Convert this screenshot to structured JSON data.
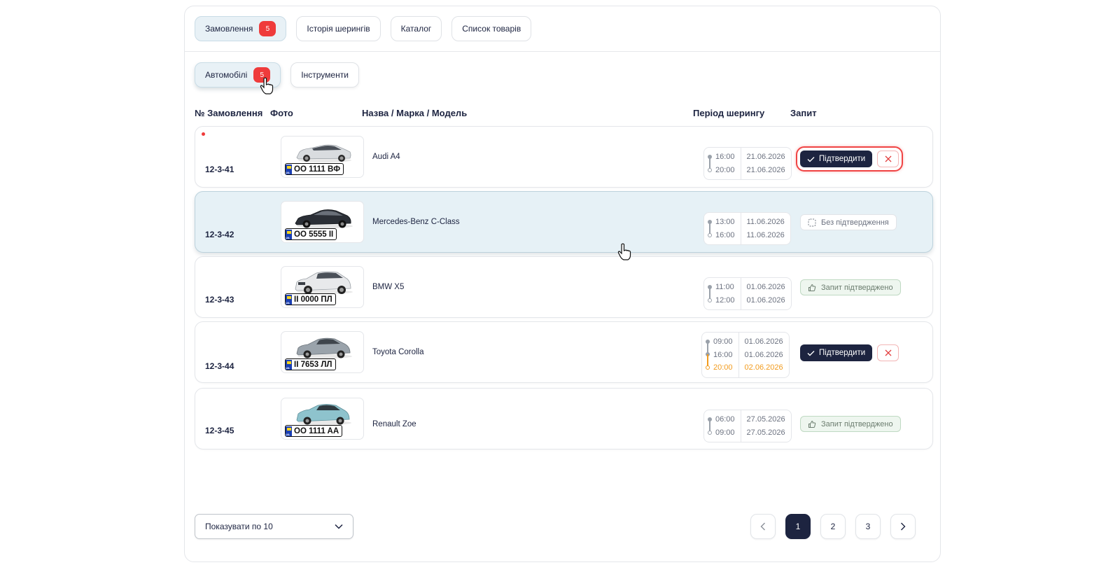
{
  "top_tabs": [
    {
      "label": "Замовлення",
      "badge": "5",
      "active": true
    },
    {
      "label": "Історія шерингів"
    },
    {
      "label": "Каталог"
    },
    {
      "label": "Список товарів"
    }
  ],
  "sub_tabs": [
    {
      "label": "Автомобілі",
      "badge": "5",
      "active": true
    },
    {
      "label": "Інструменти"
    }
  ],
  "table": {
    "headers": {
      "order": "№ Замовлення",
      "photo": "Фото",
      "name": "Назва / Марка / Модель",
      "period": "Період шерингу",
      "request": "Запит"
    },
    "rows": [
      {
        "order": "12-3-41",
        "plate": "OO 1111 BФ",
        "name": "Audi A4",
        "times": [
          "16:00",
          "20:00"
        ],
        "dates": [
          "21.06.2026",
          "21.06.2026"
        ],
        "confirm_label": "Підтвердити"
      },
      {
        "order": "12-3-42",
        "plate": "OO 5555 II",
        "name": "Mercedes-Benz C-Class",
        "times": [
          "13:00",
          "16:00"
        ],
        "dates": [
          "11.06.2026",
          "11.06.2026"
        ],
        "status": "Без підтвердження"
      },
      {
        "order": "12-3-43",
        "plate": "II 0000 ПЛ",
        "name": "BMW X5",
        "times": [
          "11:00",
          "12:00"
        ],
        "dates": [
          "01.06.2026",
          "01.06.2026"
        ],
        "status": "Запит підтверджено"
      },
      {
        "order": "12-3-44",
        "plate": "II 7653 ЛЛ",
        "name": "Toyota Corolla",
        "times": [
          "09:00",
          "16:00",
          "20:00"
        ],
        "dates": [
          "01.06.2026",
          "01.06.2026",
          "02.06.2026"
        ],
        "confirm_label": "Підтвердити"
      },
      {
        "order": "12-3-45",
        "plate": "OO 1111 AA",
        "name": "Renault Zoe",
        "times": [
          "06:00",
          "09:00"
        ],
        "dates": [
          "27.05.2026",
          "27.05.2026"
        ],
        "status": "Запит підтверджено"
      }
    ]
  },
  "page_size_label": "Показувати по 10",
  "pagination": [
    "1",
    "2",
    "3"
  ],
  "colors": {
    "accent_dark": "#1d2440",
    "badge_red": "#ef3b3b",
    "highlight_row": "#e6f1f6",
    "extended_time": "#f29b1d",
    "confirmed_green": "#eef6ef"
  },
  "car_colors": [
    "#d9dcdf",
    "#2b2f36",
    "#e8e9eb",
    "#9aa3ab",
    "#8ec3cd"
  ]
}
